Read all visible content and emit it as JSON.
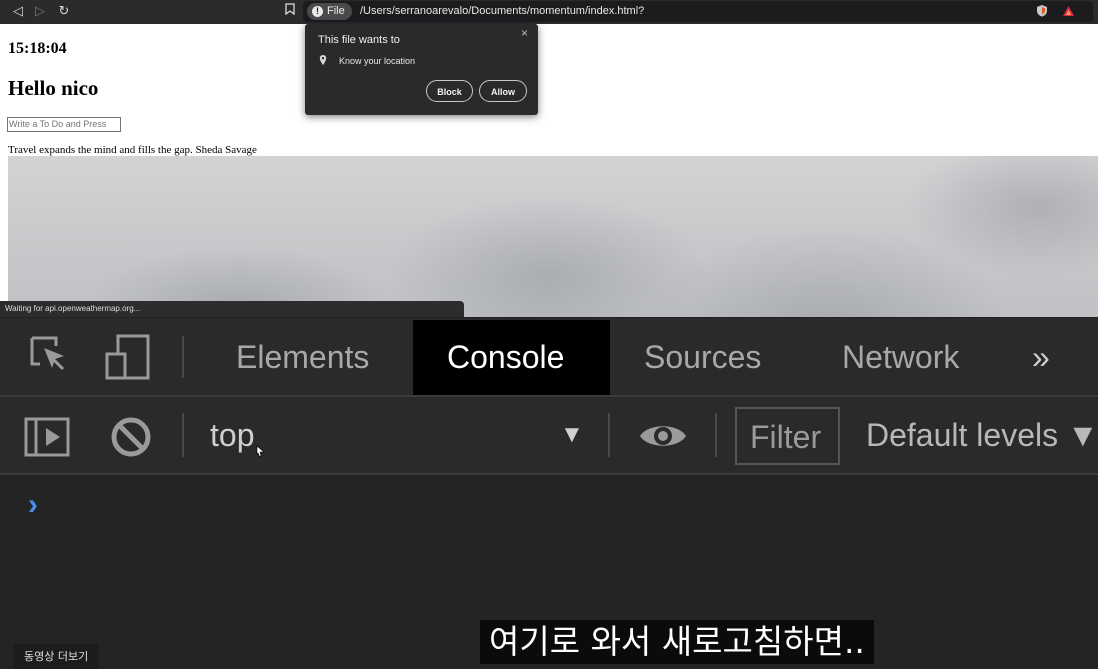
{
  "browser": {
    "scheme_chip": "File",
    "url": "/Users/serranoarevalo/Documents/momentum/index.html?",
    "nav_back_icon": "chevron-left-icon",
    "nav_forward_icon": "chevron-right-icon",
    "reload_icon": "reload-icon",
    "bookmark_icon": "bookmark-icon",
    "status_text": "Waiting for api.openweathermap.org..."
  },
  "page": {
    "clock": "15:18:04",
    "greeting": "Hello nico",
    "todo_placeholder": "Write a To Do and Press",
    "quote": "Travel expands the mind and fills the gap. Sheda Savage"
  },
  "permission": {
    "title": "This file wants to",
    "request": "Know your location",
    "close": "×",
    "block_label": "Block",
    "allow_label": "Allow"
  },
  "devtools": {
    "tabs": [
      {
        "label": "Elements"
      },
      {
        "label": "Console",
        "active": true
      },
      {
        "label": "Sources"
      },
      {
        "label": "Network"
      }
    ],
    "more_tabs": "»",
    "context": "top",
    "context_arrow": "▼",
    "filter_label": "Filter",
    "levels": "Default levels ▼",
    "prompt": "›"
  },
  "video": {
    "more_videos": "동영상 더보기",
    "subtitle": "여기로 와서 새로고침하면.."
  },
  "colors": {
    "console_prompt": "#4a8ef0",
    "active_tab_bg": "#000000",
    "devtools_bg": "#242424"
  }
}
